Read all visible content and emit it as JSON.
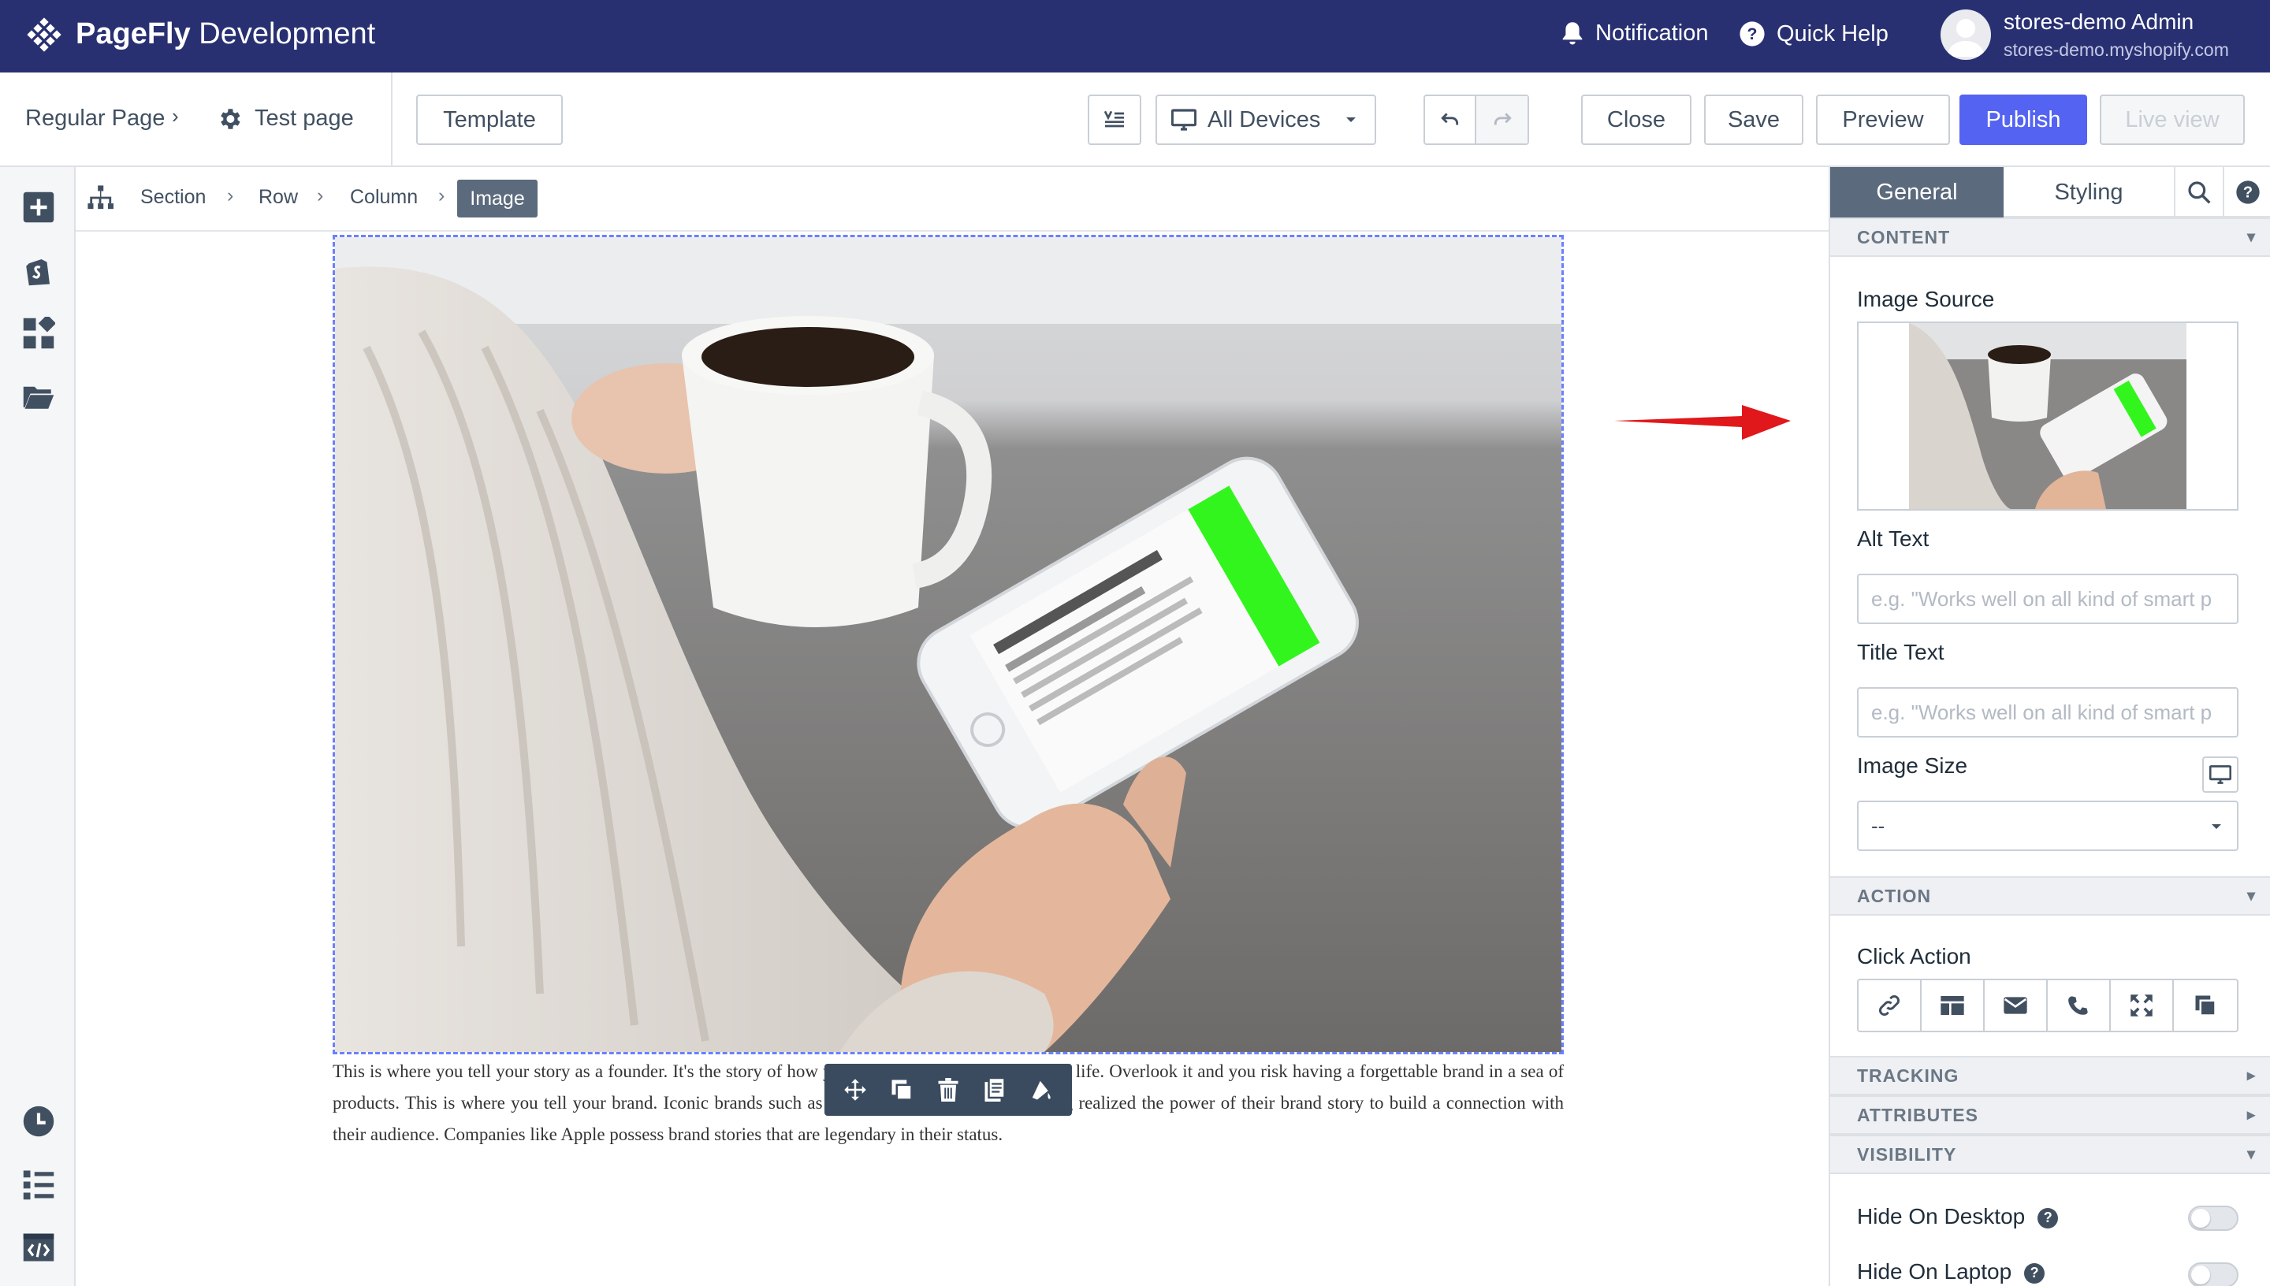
{
  "app": {
    "brand_bold": "PageFly",
    "brand_rest": " Development",
    "notification": "Notification",
    "quick_help": "Quick Help",
    "user_name": "stores-demo Admin",
    "user_shop": "stores-demo.myshopify.com"
  },
  "toolbar": {
    "page_type": "Regular Page",
    "page_name": "Test page",
    "template": "Template",
    "devices": "All Devices",
    "close": "Close",
    "save": "Save",
    "preview": "Preview",
    "publish": "Publish",
    "live_view": "Live view"
  },
  "breadcrumb": [
    "Section",
    "Row",
    "Column",
    "Image"
  ],
  "canvas": {
    "story_text": "This is where you tell your story as a founder. It's the story of how your brand brings your mission to life. Overlook it and you risk having a forgettable brand in a sea of products. This is where you tell your brand. Iconic brands such as Disney and Coca-Cola have long realized the power of their brand story to build a connection with their audience. Companies like Apple possess brand stories that are legendary in their status."
  },
  "panel": {
    "tabs": [
      "General",
      "Styling"
    ],
    "content_header": "CONTENT",
    "image_source_label": "Image Source",
    "alt_text_label": "Alt Text",
    "alt_placeholder": "e.g. \"Works well on all kind of smart p",
    "title_text_label": "Title Text",
    "title_placeholder": "e.g. \"Works well on all kind of smart p",
    "image_size_label": "Image Size",
    "image_size_value": "--",
    "action_header": "ACTION",
    "click_action_label": "Click Action",
    "tracking_header": "TRACKING",
    "attributes_header": "ATTRIBUTES",
    "visibility_header": "VISIBILITY",
    "hide_desktop": "Hide On Desktop",
    "hide_laptop": "Hide On Laptop"
  },
  "colors": {
    "topbar": "#293072",
    "publish": "#5463f2",
    "arrow": "#e0171b",
    "selection": "#6b80ff"
  }
}
